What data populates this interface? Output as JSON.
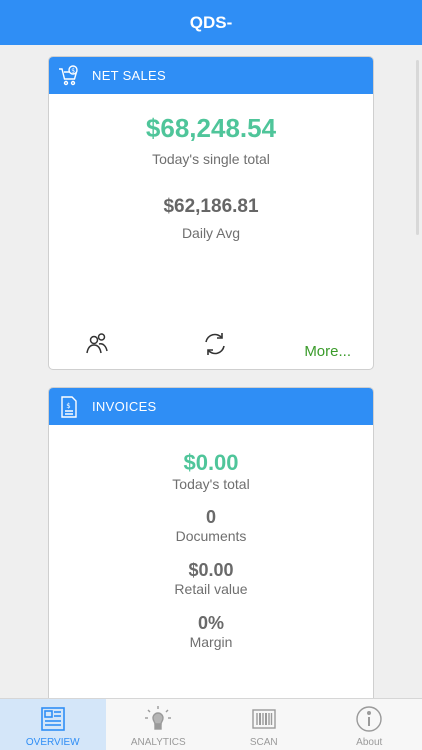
{
  "header": {
    "title": "QDS-"
  },
  "net_sales": {
    "title": "NET SALES",
    "amount": "$68,248.54",
    "amount_label": "Today's single total",
    "daily_avg": "$62,186.81",
    "daily_avg_label": "Daily Avg",
    "more_label": "More..."
  },
  "invoices": {
    "title": "INVOICES",
    "items": [
      {
        "value": "$0.00",
        "label": "Today's total"
      },
      {
        "value": "0",
        "label": "Documents"
      },
      {
        "value": "$0.00",
        "label": "Retail value"
      },
      {
        "value": "0%",
        "label": "Margin"
      }
    ]
  },
  "tabs": [
    {
      "label": "OVERVIEW",
      "icon": "overview-icon",
      "active": true
    },
    {
      "label": "ANALYTICS",
      "icon": "lightbulb-icon",
      "active": false
    },
    {
      "label": "SCAN",
      "icon": "barcode-icon",
      "active": false
    },
    {
      "label": "About",
      "icon": "info-icon",
      "active": false
    }
  ],
  "colors": {
    "primary": "#2f8ef5",
    "accent_green": "#4fc59a",
    "link_green": "#3a9b2a"
  }
}
